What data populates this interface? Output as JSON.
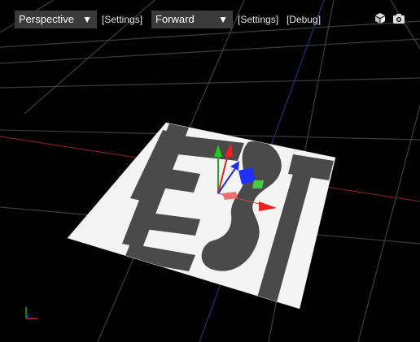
{
  "toolbar": {
    "camera_mode": {
      "selected": "Perspective"
    },
    "settings_1": "[Settings]",
    "render_path": {
      "selected": "Forward"
    },
    "settings_2": "[Settings]",
    "debug": "[Debug]",
    "icons": [
      "cube-icon",
      "camera-icon"
    ]
  },
  "scene": {
    "plane_texture_text": "TEST",
    "colors": {
      "background": "#000000",
      "grid": "#3c3c3c",
      "x_axis": "#c0392b",
      "y_axis": "#2c3e9e",
      "gizmo_x": "#ff2020",
      "gizmo_y": "#20d020",
      "gizmo_z": "#2040ff"
    }
  }
}
